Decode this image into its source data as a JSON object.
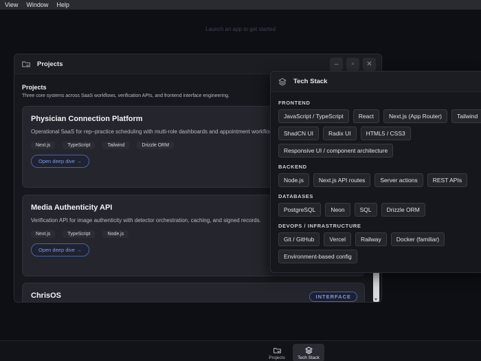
{
  "menubar": {
    "items": [
      "View",
      "Window",
      "Help"
    ]
  },
  "desktop": {
    "hint": "Launch an app to get started"
  },
  "projects_window": {
    "title": "Projects",
    "controls": {
      "minimize": "–",
      "maximize": "▫",
      "close": "✕"
    },
    "heading": "Projects",
    "subtitle": "Three core systems across SaaS workflows, verification APIs, and frontend interface engineering.",
    "cards": [
      {
        "title": "Physician Connection Platform",
        "description": "Operational SaaS for rep–practice scheduling with multi-role dashboards and appointment workflows.",
        "tags": [
          "Next.js",
          "TypeScript",
          "Tailwind",
          "Drizzle ORM"
        ],
        "button": "Open deep dive →"
      },
      {
        "title": "Media Authenticity API",
        "description": "Verification API for image authenticity with detector orchestration, caching, and signed records.",
        "tags": [
          "Next.js",
          "TypeScript",
          "Node.js"
        ],
        "button": "Open deep dive →"
      },
      {
        "title": "ChrisOS",
        "badge": "INTERFACE"
      }
    ]
  },
  "tech_window": {
    "title": "Tech Stack",
    "sections": [
      {
        "name": "FRONTEND",
        "chips": [
          "JavaScript / TypeScript",
          "React",
          "Next.js (App Router)",
          "Tailwind",
          "ShadCN UI",
          "Radix UI",
          "HTML5 / CSS3",
          "Responsive UI / component architecture"
        ]
      },
      {
        "name": "BACKEND",
        "chips": [
          "Node.js",
          "Next.js API routes",
          "Server actions",
          "REST APIs"
        ]
      },
      {
        "name": "DATABASES",
        "chips": [
          "PostgreSQL",
          "Neon",
          "SQL",
          "Drizzle ORM"
        ]
      },
      {
        "name": "DEVOPS / INFRASTRUCTURE",
        "chips": [
          "Git / GitHub",
          "Vercel",
          "Railway",
          "Docker (familiar)",
          "Environment-based config"
        ]
      }
    ]
  },
  "taskbar": {
    "items": [
      {
        "label": "Projects",
        "active": false
      },
      {
        "label": "Tech Stack",
        "active": true
      }
    ]
  }
}
